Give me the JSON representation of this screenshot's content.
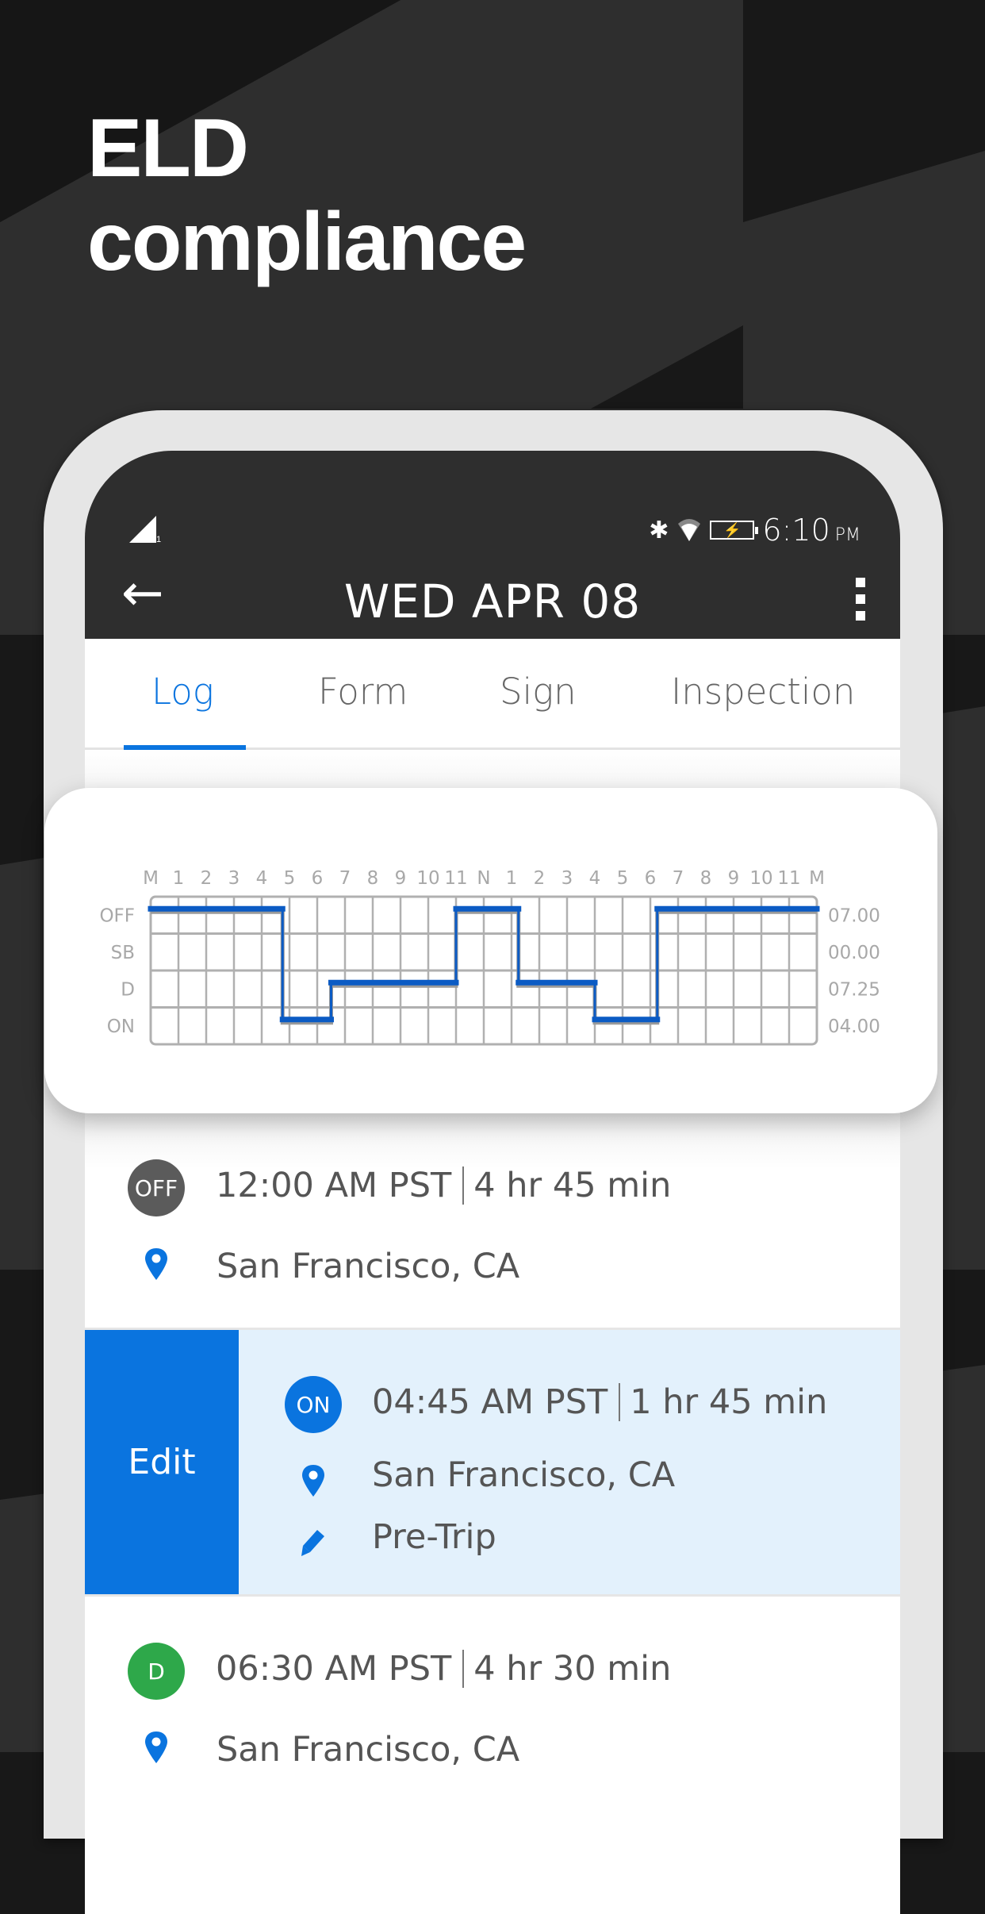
{
  "headline": {
    "line1": "ELD",
    "line2": "compliance"
  },
  "status_bar": {
    "signal_sub": "1",
    "bluetooth_icon": "bluetooth-icon",
    "wifi_icon": "wifi-icon",
    "battery_icon": "battery-charging-icon",
    "battery_glyph": "⚡",
    "time": "6:10",
    "ampm": "PM"
  },
  "appbar": {
    "back_icon": "arrow-left-icon",
    "back_glyph": "←",
    "title": "WED APR 08",
    "menu_icon": "more-vert-icon"
  },
  "tabs": [
    {
      "label": "Log",
      "active": true
    },
    {
      "label": "Form",
      "active": false
    },
    {
      "label": "Sign",
      "active": false
    },
    {
      "label": "Inspection",
      "active": false
    }
  ],
  "colors": {
    "accent": "#0a74df",
    "off": "#5b5b5b",
    "on": "#0a74df",
    "driving": "#2ea84a",
    "selected_row": "#e3f1fc",
    "log_line": "#0b5bc4"
  },
  "chart_data": {
    "type": "line",
    "title": "",
    "x_tick_labels": [
      "M",
      "1",
      "2",
      "3",
      "4",
      "5",
      "6",
      "7",
      "8",
      "9",
      "10",
      "11",
      "N",
      "1",
      "2",
      "3",
      "4",
      "5",
      "6",
      "7",
      "8",
      "9",
      "10",
      "11",
      "M"
    ],
    "x_range_hours": [
      0,
      24
    ],
    "y_categories": [
      "OFF",
      "SB",
      "D",
      "ON"
    ],
    "totals": [
      "07.00",
      "00.00",
      "07.25",
      "04.00"
    ],
    "segments": [
      {
        "status": "OFF",
        "start": 0,
        "end": 4.75
      },
      {
        "status": "ON",
        "start": 4.75,
        "end": 6.5
      },
      {
        "status": "D",
        "start": 6.5,
        "end": 11
      },
      {
        "status": "OFF",
        "start": 11,
        "end": 13.25
      },
      {
        "status": "D",
        "start": 13.25,
        "end": 16
      },
      {
        "status": "ON",
        "start": 16,
        "end": 18.25
      },
      {
        "status": "OFF",
        "start": 18.25,
        "end": 24
      }
    ],
    "grid": true
  },
  "entries": [
    {
      "badge": "OFF",
      "time": "12:00 AM PST",
      "duration": "4 hr 45 min",
      "location": "San Francisco, CA"
    },
    {
      "badge": "ON",
      "time": "04:45 AM PST",
      "duration": "1 hr 45 min",
      "location": "San Francisco, CA",
      "note": "Pre-Trip",
      "edit_label": "Edit"
    },
    {
      "badge": "D",
      "time": "06:30 AM PST",
      "duration": "4 hr 30 min",
      "location": "San Francisco, CA"
    }
  ]
}
